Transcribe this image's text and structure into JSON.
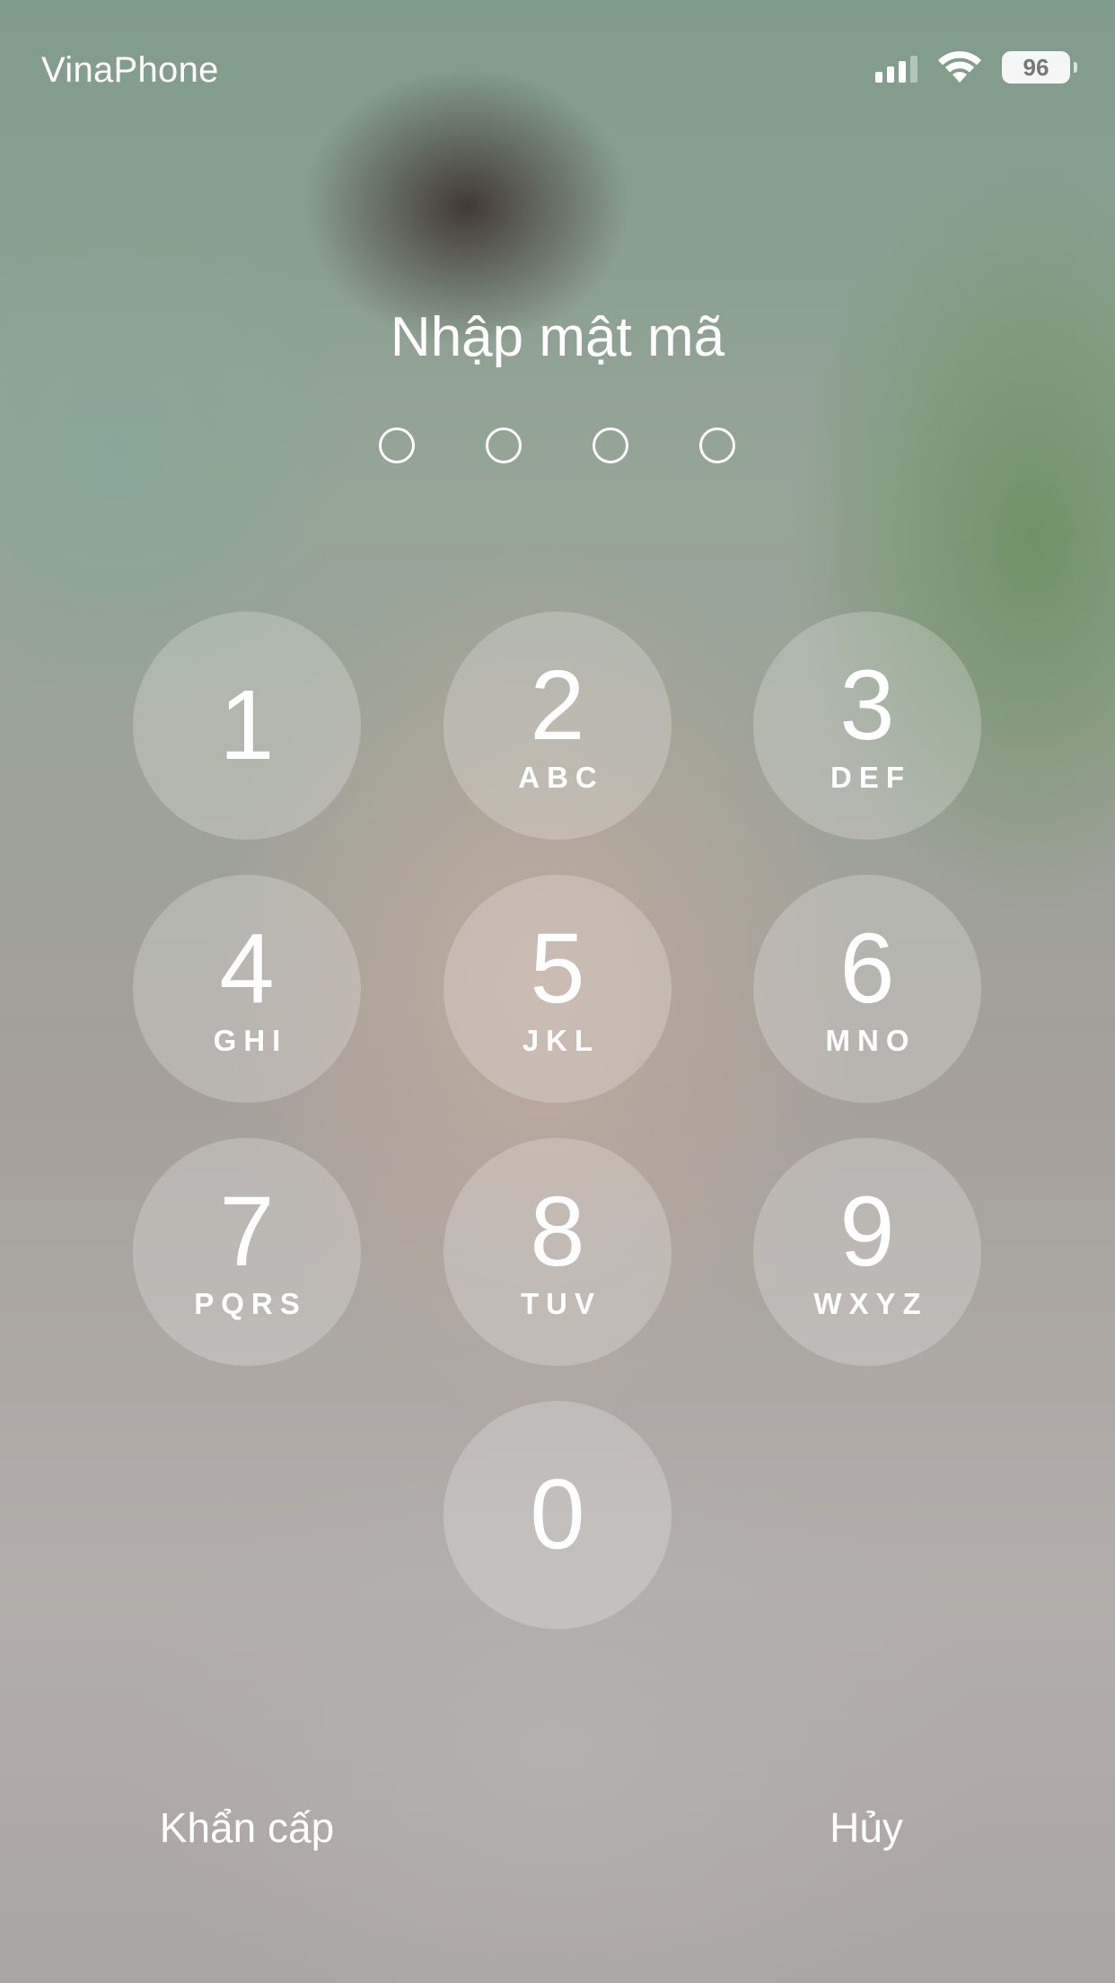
{
  "status_bar": {
    "carrier": "VinaPhone",
    "battery": "96",
    "signal_icon": "cellular-signal-icon",
    "wifi_icon": "wifi-icon"
  },
  "passcode": {
    "title": "Nhập mật mã",
    "entered_digits": 0,
    "total_digits": 4
  },
  "keypad": {
    "k1": {
      "digit": "1",
      "letters": ""
    },
    "k2": {
      "digit": "2",
      "letters": "ABC"
    },
    "k3": {
      "digit": "3",
      "letters": "DEF"
    },
    "k4": {
      "digit": "4",
      "letters": "GHI"
    },
    "k5": {
      "digit": "5",
      "letters": "JKL"
    },
    "k6": {
      "digit": "6",
      "letters": "MNO"
    },
    "k7": {
      "digit": "7",
      "letters": "PQRS"
    },
    "k8": {
      "digit": "8",
      "letters": "TUV"
    },
    "k9": {
      "digit": "9",
      "letters": "WXYZ"
    },
    "k0": {
      "digit": "0",
      "letters": ""
    }
  },
  "bottom": {
    "emergency": "Khẩn cấp",
    "cancel": "Hủy"
  }
}
